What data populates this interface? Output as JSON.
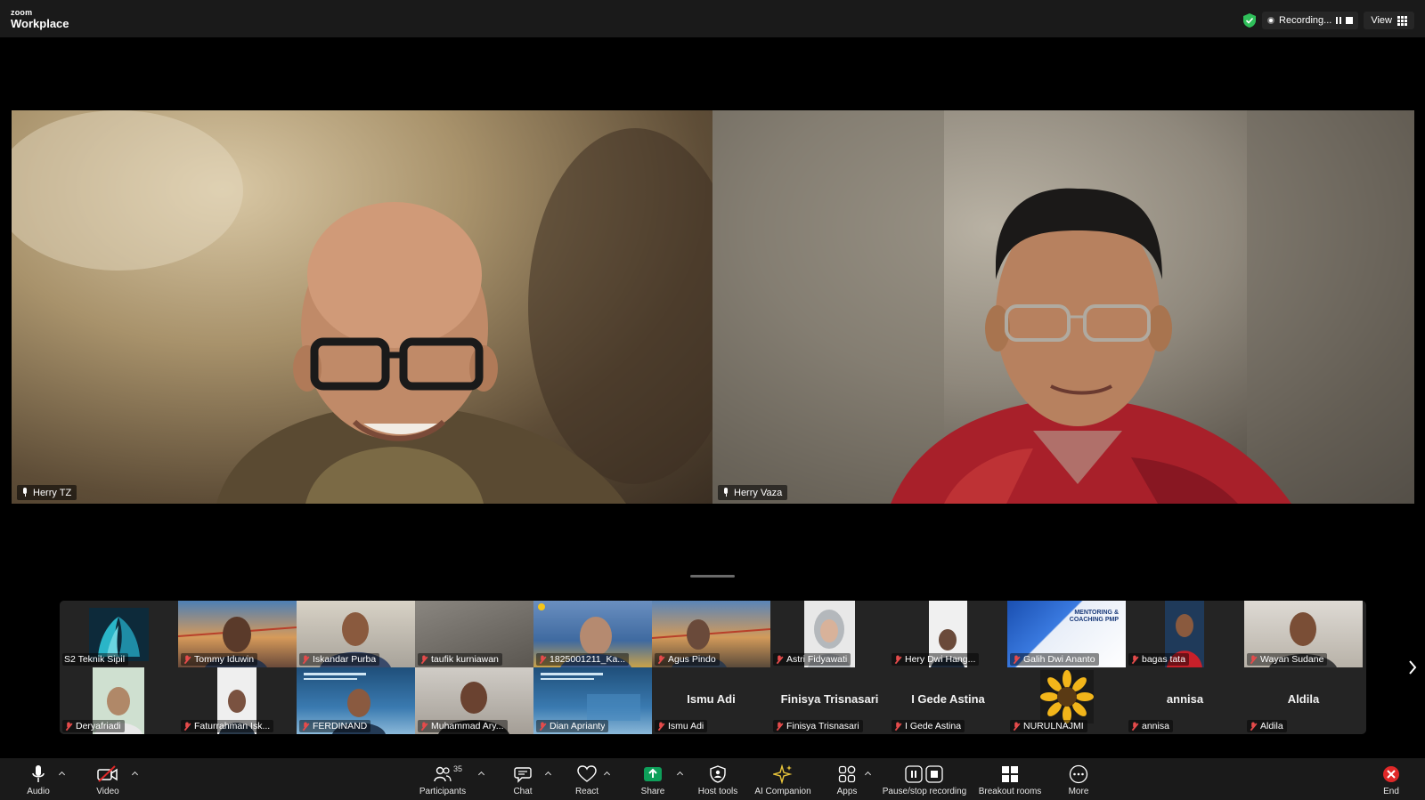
{
  "app": {
    "logo_top": "zoom",
    "logo_bottom": "Workplace"
  },
  "top_right": {
    "recording_label": "Recording...",
    "view_label": "View"
  },
  "speakers": [
    {
      "name": "Herry TZ"
    },
    {
      "name": "Herry Vaza"
    }
  ],
  "gallery": {
    "row1": [
      {
        "name": "S2 Teknik Sipil",
        "muted": false,
        "big": ""
      },
      {
        "name": "Tommy Iduwin",
        "muted": true,
        "big": ""
      },
      {
        "name": "Iskandar  Purba",
        "muted": true,
        "big": ""
      },
      {
        "name": "taufik kurniawan",
        "muted": true,
        "big": ""
      },
      {
        "name": "1825001211_Ka...",
        "muted": true,
        "big": ""
      },
      {
        "name": "Agus Pindo",
        "muted": true,
        "big": ""
      },
      {
        "name": "Astri Fidyawati",
        "muted": true,
        "big": ""
      },
      {
        "name": "Hery Dwi Hang...",
        "muted": true,
        "big": ""
      },
      {
        "name": "Galih Dwi Ananto",
        "muted": true,
        "big": ""
      },
      {
        "name": "bagas tata",
        "muted": true,
        "big": ""
      },
      {
        "name": "Wayan Sudane",
        "muted": true,
        "big": ""
      }
    ],
    "row2": [
      {
        "name": "Deryafriadi",
        "muted": true,
        "big": ""
      },
      {
        "name": "Faturrahman Isk...",
        "muted": true,
        "big": ""
      },
      {
        "name": "FERDINAND",
        "muted": true,
        "big": ""
      },
      {
        "name": "Muhammad Ary...",
        "muted": true,
        "big": ""
      },
      {
        "name": "Dian Aprianty",
        "muted": true,
        "big": ""
      },
      {
        "name": "Ismu Adi",
        "muted": true,
        "big": "Ismu Adi"
      },
      {
        "name": "Finisya Trisnasari",
        "muted": true,
        "big": "Finisya Trisnasari"
      },
      {
        "name": "I Gede Astina",
        "muted": true,
        "big": "I Gede Astina"
      },
      {
        "name": "NURULNAJMI",
        "muted": true,
        "big": ""
      },
      {
        "name": "annisa",
        "muted": true,
        "big": "annisa"
      },
      {
        "name": "Aldila",
        "muted": true,
        "big": "Aldila"
      }
    ],
    "poster_text": "MENTORING & COACHING PMP"
  },
  "toolbar": {
    "audio": "Audio",
    "video": "Video",
    "participants": "Participants",
    "participants_count": "35",
    "chat": "Chat",
    "react": "React",
    "share": "Share",
    "host_tools": "Host tools",
    "ai_companion": "AI Companion",
    "apps": "Apps",
    "pause_stop": "Pause/stop recording",
    "breakout": "Breakout rooms",
    "more": "More",
    "end": "End"
  },
  "colors": {
    "share_green": "#0e9f5a",
    "end_red": "#e02828",
    "mute_red": "#e54b4b",
    "shield_green": "#2fbf5a"
  }
}
